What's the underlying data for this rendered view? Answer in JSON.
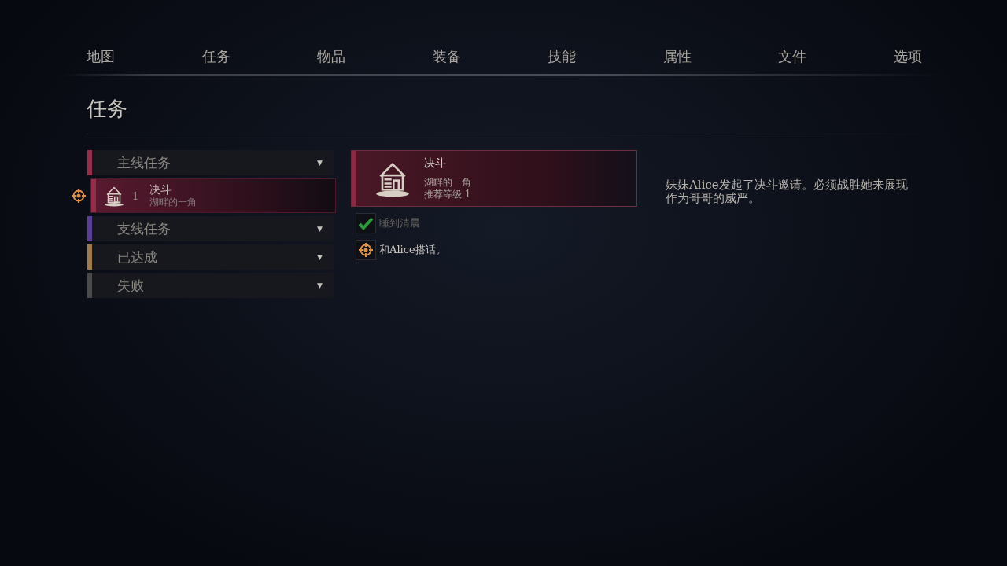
{
  "tabs": [
    {
      "label": "地图"
    },
    {
      "label": "任务"
    },
    {
      "label": "物品"
    },
    {
      "label": "装备"
    },
    {
      "label": "技能"
    },
    {
      "label": "属性"
    },
    {
      "label": "文件"
    },
    {
      "label": "选项"
    }
  ],
  "page_title": "任务",
  "categories": [
    {
      "label": "主线任务",
      "color": "#9a2c4a",
      "caret": "▼",
      "quests": [
        {
          "title": "决斗",
          "location": "湖畔的一角",
          "level": "1",
          "tracked": true,
          "selected": true
        }
      ]
    },
    {
      "label": "支线任务",
      "color": "#5a3c9a",
      "caret": "▼"
    },
    {
      "label": "已达成",
      "color": "#a07a4a",
      "caret": "▼"
    },
    {
      "label": "失败",
      "color": "#4a4a4a",
      "caret": "▼"
    }
  ],
  "detail": {
    "title": "决斗",
    "location": "湖畔的一角",
    "level_text": "推荐等级 1",
    "objectives": [
      {
        "kind": "done",
        "text": "睡到清晨"
      },
      {
        "kind": "active",
        "text": "和Alice搭话。"
      }
    ],
    "description": "妹妹Alice发起了决斗邀请。必须战胜她来展现作为哥哥的威严。"
  }
}
